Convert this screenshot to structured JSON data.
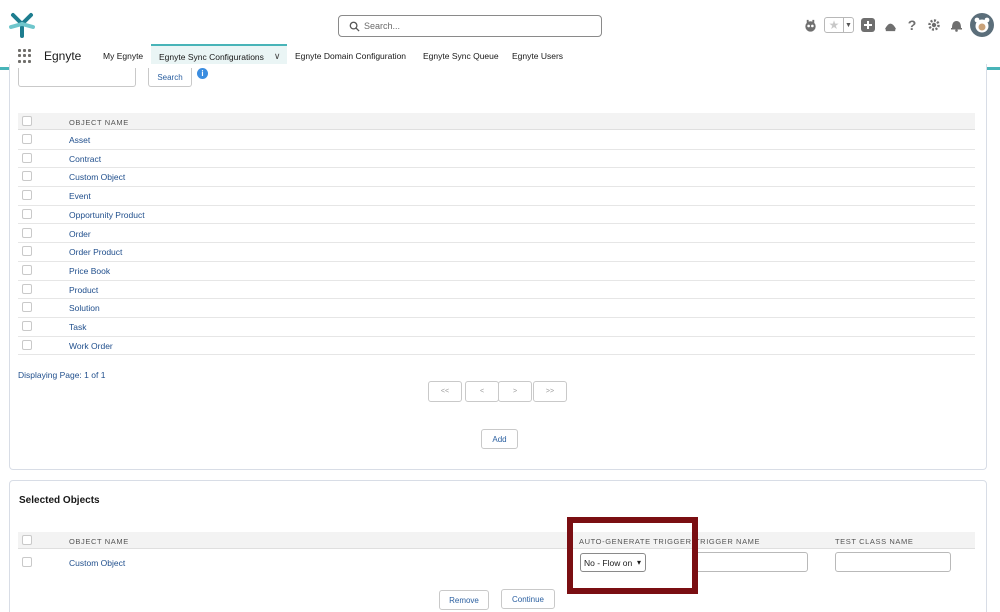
{
  "header": {
    "search_placeholder": "Search...",
    "icons": [
      "einstein-icon",
      "favorite-star-icon",
      "favorites-dropdown-icon",
      "add-icon",
      "trailhead-icon",
      "help-icon",
      "setup-gear-icon",
      "notification-bell-icon",
      "user-avatar"
    ]
  },
  "nav": {
    "app_name": "Egnyte",
    "tabs": [
      {
        "label": "My Egnyte"
      },
      {
        "label": "Egnyte Sync Configurations"
      },
      {
        "label": "Egnyte Domain Configuration"
      },
      {
        "label": "Egnyte Sync Queue"
      },
      {
        "label": "Egnyte Users"
      }
    ]
  },
  "objects": {
    "search_button": "Search",
    "column_header": "OBJECT NAME",
    "rows": [
      "Asset",
      "Contract",
      "Custom Object",
      "Event",
      "Opportunity Product",
      "Order",
      "Order Product",
      "Price Book",
      "Product",
      "Solution",
      "Task",
      "Work Order"
    ],
    "page_info": "Displaying Page: 1 of 1",
    "pager": {
      "first": "<<",
      "prev": "<",
      "next": ">",
      "last": ">>"
    },
    "add_button": "Add"
  },
  "selected": {
    "title": "Selected Objects",
    "columns": {
      "object_name": "OBJECT NAME",
      "auto_generate": "AUTO-GENERATE TRIGGER",
      "trigger_name": "TRIGGER NAME",
      "test_class": "TEST CLASS NAME"
    },
    "row_label": "Custom Object",
    "auto_generate_value": "No - Flow on",
    "remove_button": "Remove",
    "continue_button": "Continue"
  },
  "colors": {
    "accent": "#48b4b8",
    "link": "#1f4e8c",
    "highlight": "#7a0e12"
  }
}
